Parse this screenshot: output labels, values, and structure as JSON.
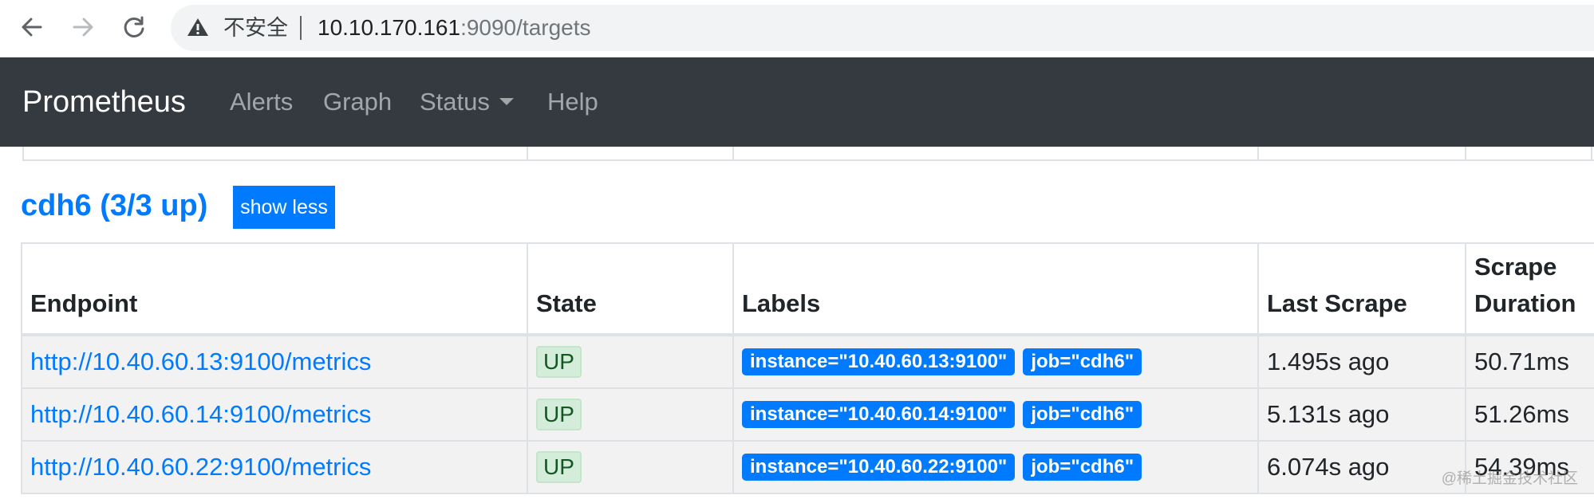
{
  "browser": {
    "security_label": "不安全",
    "url_host": "10.10.170.161",
    "url_rest": ":9090/targets"
  },
  "navbar": {
    "brand": "Prometheus",
    "links": [
      "Alerts",
      "Graph",
      "Status",
      "Help"
    ]
  },
  "job": {
    "title": "cdh6 (3/3 up)",
    "toggle_label": "show less"
  },
  "table": {
    "headers": {
      "endpoint": "Endpoint",
      "state": "State",
      "labels": "Labels",
      "last_scrape": "Last Scrape",
      "duration_line1": "Scrape",
      "duration_line2": "Duration"
    },
    "rows": [
      {
        "endpoint": "http://10.40.60.13:9100/metrics",
        "state": "UP",
        "labels": [
          "instance=\"10.40.60.13:9100\"",
          "job=\"cdh6\""
        ],
        "last_scrape": "1.495s ago",
        "duration": "50.71ms"
      },
      {
        "endpoint": "http://10.40.60.14:9100/metrics",
        "state": "UP",
        "labels": [
          "instance=\"10.40.60.14:9100\"",
          "job=\"cdh6\""
        ],
        "last_scrape": "5.131s ago",
        "duration": "51.26ms"
      },
      {
        "endpoint": "http://10.40.60.22:9100/metrics",
        "state": "UP",
        "labels": [
          "instance=\"10.40.60.22:9100\"",
          "job=\"cdh6\""
        ],
        "last_scrape": "6.074s ago",
        "duration": "54.39ms"
      }
    ]
  },
  "watermark": "@稀土掘金技术社区"
}
